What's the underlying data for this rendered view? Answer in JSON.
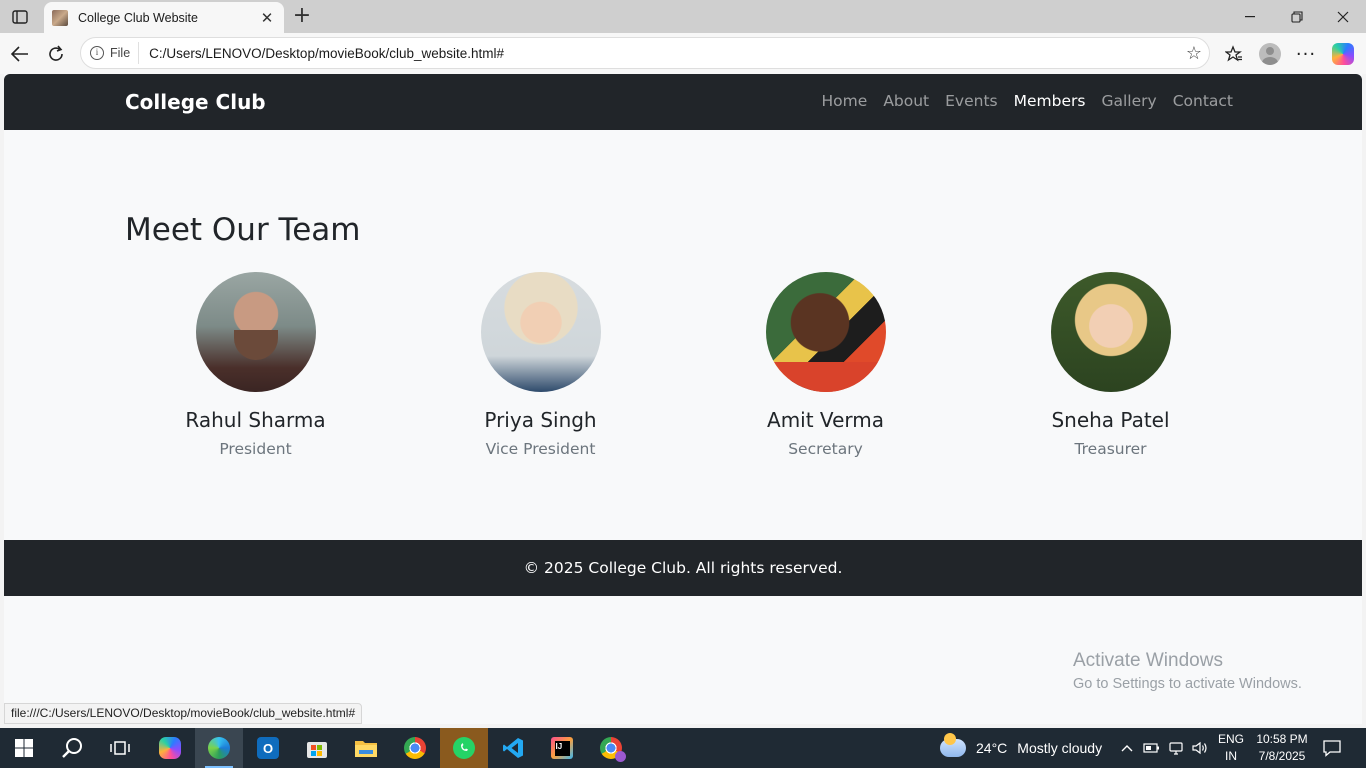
{
  "browser": {
    "tab_title": "College Club Website",
    "address_label": "File",
    "address_url": "C:/Users/LENOVO/Desktop/movieBook/club_website.html#",
    "status_url": "file:///C:/Users/LENOVO/Desktop/movieBook/club_website.html#"
  },
  "site": {
    "brand": "College Club",
    "nav": [
      {
        "label": "Home"
      },
      {
        "label": "About"
      },
      {
        "label": "Events"
      },
      {
        "label": "Members"
      },
      {
        "label": "Gallery"
      },
      {
        "label": "Contact"
      }
    ],
    "active_nav": "Members",
    "section_title": "Meet Our Team",
    "members": [
      {
        "name": "Rahul Sharma",
        "role": "President"
      },
      {
        "name": "Priya Singh",
        "role": "Vice President"
      },
      {
        "name": "Amit Verma",
        "role": "Secretary"
      },
      {
        "name": "Sneha Patel",
        "role": "Treasurer"
      }
    ],
    "footer": "© 2025 College Club. All rights reserved."
  },
  "watermark": {
    "line1": "Activate Windows",
    "line2": "Go to Settings to activate Windows."
  },
  "taskbar": {
    "weather_temp": "24°C",
    "weather_desc": "Mostly cloudy",
    "lang_line1": "ENG",
    "lang_line2": "IN",
    "time": "10:58 PM",
    "date": "7/8/2025"
  },
  "colors": {
    "navbar_bg": "#212529",
    "page_bg": "#f8f9fa",
    "muted_text": "#6c757d",
    "taskbar_bg": "#1f2a34"
  }
}
